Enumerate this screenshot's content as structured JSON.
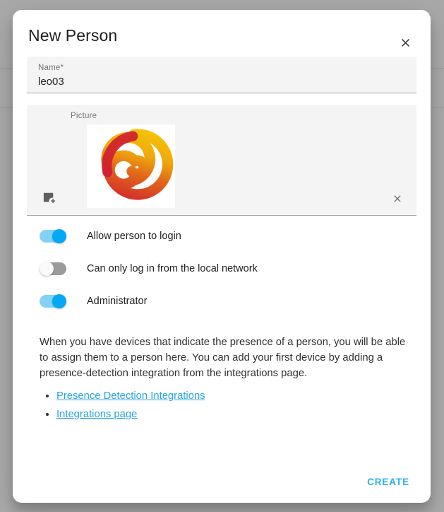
{
  "dialog": {
    "title": "New Person",
    "close_icon": "close-icon"
  },
  "name_field": {
    "label": "Name*",
    "value": "leo03",
    "placeholder": "Name"
  },
  "picture_field": {
    "label": "Picture",
    "add_icon": "add-photo-icon",
    "clear_icon": "clear-icon",
    "image_alt": "red and yellow brush spiral"
  },
  "toggles": [
    {
      "label": "Allow person to login",
      "state": "on"
    },
    {
      "label": "Can only log in from the local network",
      "state": "off"
    },
    {
      "label": "Administrator",
      "state": "on"
    }
  ],
  "description": "When you have devices that indicate the presence of a person, you will be able to assign them to a person here. You can add your first device by adding a presence-detection integration from the integrations page.",
  "links": [
    {
      "label": "Presence Detection Integrations"
    },
    {
      "label": "Integrations page"
    }
  ],
  "footer": {
    "create_label": "CREATE"
  },
  "colors": {
    "accent": "#03a9f4",
    "link": "#25a4e0",
    "create": "#29b0ec",
    "toggle_on_track": "#83d2f5",
    "toggle_off_track": "#9b9b9b",
    "field_bg": "#f4f4f4",
    "backdrop": "#a9a9a9",
    "spiral_red": "#cf2030",
    "spiral_orange": "#ea7b1b",
    "spiral_yellow": "#f6cc07"
  }
}
